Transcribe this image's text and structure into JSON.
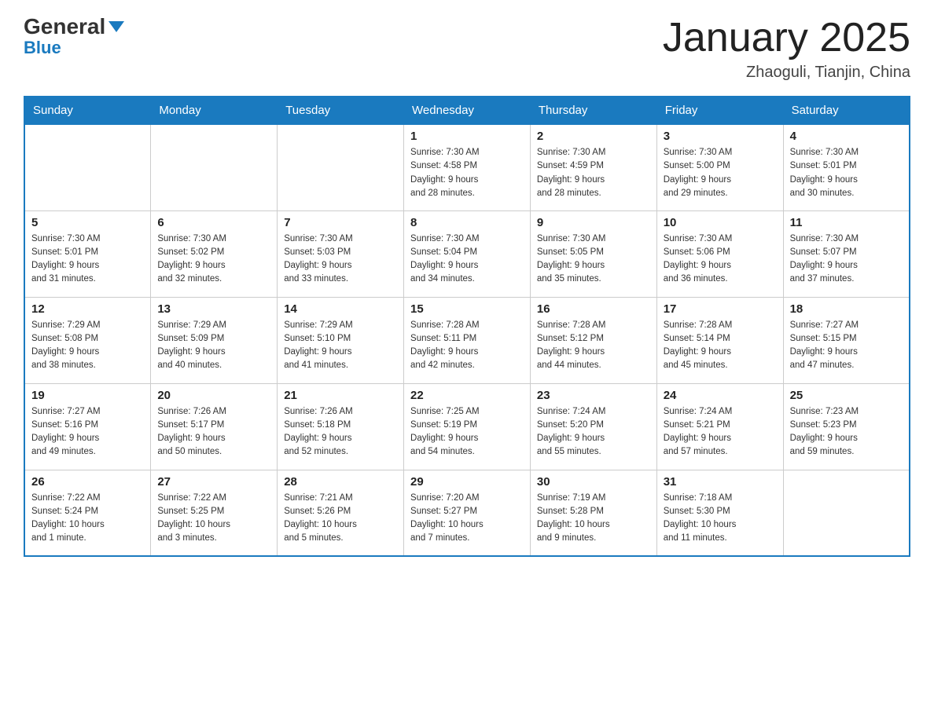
{
  "header": {
    "logo_general": "General",
    "logo_blue": "Blue",
    "month_title": "January 2025",
    "location": "Zhaoguli, Tianjin, China"
  },
  "columns": [
    "Sunday",
    "Monday",
    "Tuesday",
    "Wednesday",
    "Thursday",
    "Friday",
    "Saturday"
  ],
  "weeks": [
    [
      {
        "day": "",
        "info": ""
      },
      {
        "day": "",
        "info": ""
      },
      {
        "day": "",
        "info": ""
      },
      {
        "day": "1",
        "info": "Sunrise: 7:30 AM\nSunset: 4:58 PM\nDaylight: 9 hours\nand 28 minutes."
      },
      {
        "day": "2",
        "info": "Sunrise: 7:30 AM\nSunset: 4:59 PM\nDaylight: 9 hours\nand 28 minutes."
      },
      {
        "day": "3",
        "info": "Sunrise: 7:30 AM\nSunset: 5:00 PM\nDaylight: 9 hours\nand 29 minutes."
      },
      {
        "day": "4",
        "info": "Sunrise: 7:30 AM\nSunset: 5:01 PM\nDaylight: 9 hours\nand 30 minutes."
      }
    ],
    [
      {
        "day": "5",
        "info": "Sunrise: 7:30 AM\nSunset: 5:01 PM\nDaylight: 9 hours\nand 31 minutes."
      },
      {
        "day": "6",
        "info": "Sunrise: 7:30 AM\nSunset: 5:02 PM\nDaylight: 9 hours\nand 32 minutes."
      },
      {
        "day": "7",
        "info": "Sunrise: 7:30 AM\nSunset: 5:03 PM\nDaylight: 9 hours\nand 33 minutes."
      },
      {
        "day": "8",
        "info": "Sunrise: 7:30 AM\nSunset: 5:04 PM\nDaylight: 9 hours\nand 34 minutes."
      },
      {
        "day": "9",
        "info": "Sunrise: 7:30 AM\nSunset: 5:05 PM\nDaylight: 9 hours\nand 35 minutes."
      },
      {
        "day": "10",
        "info": "Sunrise: 7:30 AM\nSunset: 5:06 PM\nDaylight: 9 hours\nand 36 minutes."
      },
      {
        "day": "11",
        "info": "Sunrise: 7:30 AM\nSunset: 5:07 PM\nDaylight: 9 hours\nand 37 minutes."
      }
    ],
    [
      {
        "day": "12",
        "info": "Sunrise: 7:29 AM\nSunset: 5:08 PM\nDaylight: 9 hours\nand 38 minutes."
      },
      {
        "day": "13",
        "info": "Sunrise: 7:29 AM\nSunset: 5:09 PM\nDaylight: 9 hours\nand 40 minutes."
      },
      {
        "day": "14",
        "info": "Sunrise: 7:29 AM\nSunset: 5:10 PM\nDaylight: 9 hours\nand 41 minutes."
      },
      {
        "day": "15",
        "info": "Sunrise: 7:28 AM\nSunset: 5:11 PM\nDaylight: 9 hours\nand 42 minutes."
      },
      {
        "day": "16",
        "info": "Sunrise: 7:28 AM\nSunset: 5:12 PM\nDaylight: 9 hours\nand 44 minutes."
      },
      {
        "day": "17",
        "info": "Sunrise: 7:28 AM\nSunset: 5:14 PM\nDaylight: 9 hours\nand 45 minutes."
      },
      {
        "day": "18",
        "info": "Sunrise: 7:27 AM\nSunset: 5:15 PM\nDaylight: 9 hours\nand 47 minutes."
      }
    ],
    [
      {
        "day": "19",
        "info": "Sunrise: 7:27 AM\nSunset: 5:16 PM\nDaylight: 9 hours\nand 49 minutes."
      },
      {
        "day": "20",
        "info": "Sunrise: 7:26 AM\nSunset: 5:17 PM\nDaylight: 9 hours\nand 50 minutes."
      },
      {
        "day": "21",
        "info": "Sunrise: 7:26 AM\nSunset: 5:18 PM\nDaylight: 9 hours\nand 52 minutes."
      },
      {
        "day": "22",
        "info": "Sunrise: 7:25 AM\nSunset: 5:19 PM\nDaylight: 9 hours\nand 54 minutes."
      },
      {
        "day": "23",
        "info": "Sunrise: 7:24 AM\nSunset: 5:20 PM\nDaylight: 9 hours\nand 55 minutes."
      },
      {
        "day": "24",
        "info": "Sunrise: 7:24 AM\nSunset: 5:21 PM\nDaylight: 9 hours\nand 57 minutes."
      },
      {
        "day": "25",
        "info": "Sunrise: 7:23 AM\nSunset: 5:23 PM\nDaylight: 9 hours\nand 59 minutes."
      }
    ],
    [
      {
        "day": "26",
        "info": "Sunrise: 7:22 AM\nSunset: 5:24 PM\nDaylight: 10 hours\nand 1 minute."
      },
      {
        "day": "27",
        "info": "Sunrise: 7:22 AM\nSunset: 5:25 PM\nDaylight: 10 hours\nand 3 minutes."
      },
      {
        "day": "28",
        "info": "Sunrise: 7:21 AM\nSunset: 5:26 PM\nDaylight: 10 hours\nand 5 minutes."
      },
      {
        "day": "29",
        "info": "Sunrise: 7:20 AM\nSunset: 5:27 PM\nDaylight: 10 hours\nand 7 minutes."
      },
      {
        "day": "30",
        "info": "Sunrise: 7:19 AM\nSunset: 5:28 PM\nDaylight: 10 hours\nand 9 minutes."
      },
      {
        "day": "31",
        "info": "Sunrise: 7:18 AM\nSunset: 5:30 PM\nDaylight: 10 hours\nand 11 minutes."
      },
      {
        "day": "",
        "info": ""
      }
    ]
  ]
}
